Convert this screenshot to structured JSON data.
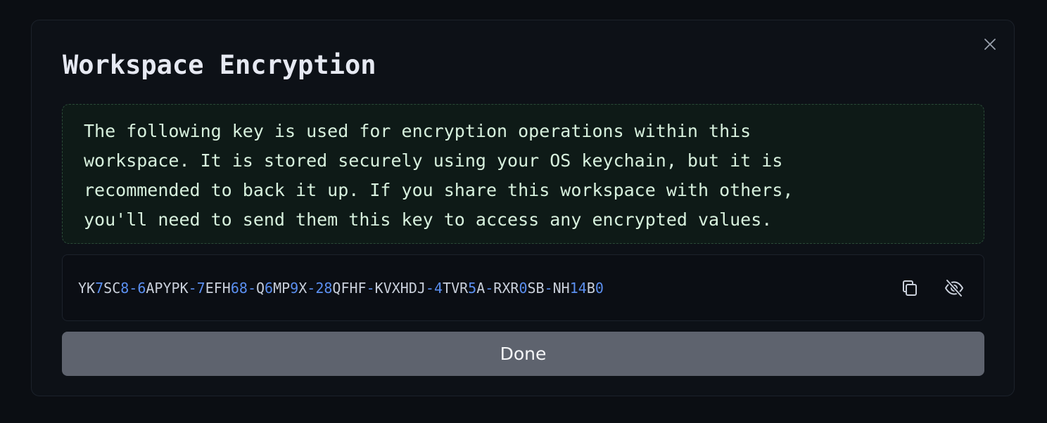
{
  "dialog": {
    "title": "Workspace Encryption",
    "notice_lines": [
      "The following key is used for encryption operations within this",
      "workspace. It is stored securely using your OS keychain, but it is",
      "recommended to back it up. If you share this workspace with others,",
      "you'll need to send them this key to access any encrypted values."
    ],
    "encryption_key": "YK7SC8-6APYPK-7EFH68-Q6MP9X-28QFHF-KVXHDJ-4TVR5A-RXR0SB-NH14B0",
    "done_label": "Done",
    "icons": {
      "close": "close-icon",
      "copy": "copy-icon",
      "hide": "eye-off-icon"
    }
  },
  "colors": {
    "background": "#0b0e13",
    "dialog_bg": "#0d1117",
    "notice_bg": "#0e1a17",
    "notice_border": "#2a4a37",
    "notice_text": "#d7f0dd",
    "key_letter": "#c9cfda",
    "key_digit_dash": "#5b8ff0",
    "button_bg": "#5e636e"
  }
}
